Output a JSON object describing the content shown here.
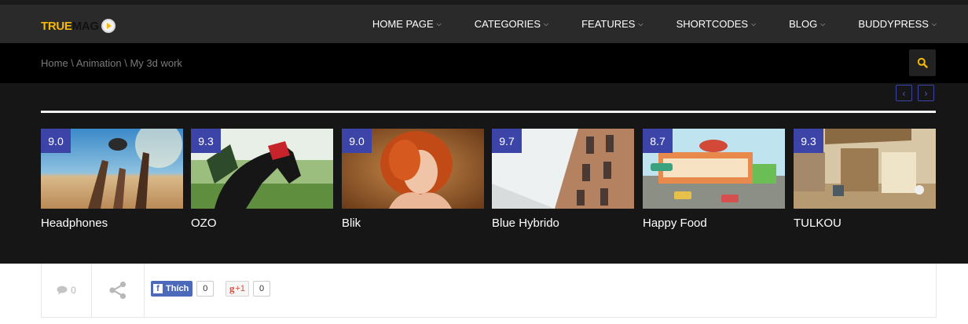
{
  "header": {
    "logo_part1": "TRUE",
    "logo_part2": "MAG",
    "menu": [
      {
        "label": "HOME PAGE"
      },
      {
        "label": "CATEGORIES"
      },
      {
        "label": "FEATURES"
      },
      {
        "label": "SHORTCODES"
      },
      {
        "label": "BLOG"
      },
      {
        "label": "BUDDYPRESS"
      }
    ]
  },
  "breadcrumb": {
    "items": [
      "Home",
      "Animation",
      "My 3d work"
    ],
    "separator": " \\ "
  },
  "carousel": {
    "items": [
      {
        "score": "9.0",
        "title": "Headphones"
      },
      {
        "score": "9.3",
        "title": "OZO"
      },
      {
        "score": "9.0",
        "title": "Blik"
      },
      {
        "score": "9.7",
        "title": "Blue Hybrido"
      },
      {
        "score": "8.7",
        "title": "Happy Food"
      },
      {
        "score": "9.3",
        "title": "TULKOU"
      }
    ]
  },
  "share": {
    "comments_count": "0",
    "facebook_label": "Thích",
    "facebook_count": "0",
    "gplus_label": "+1",
    "gplus_count": "0"
  },
  "colors": {
    "accent": "#f5b80b",
    "score_bg": "#3d44a8",
    "nav_bg": "#2a2a2a",
    "crumb_bg": "#000000",
    "carousel_bg": "#161616"
  }
}
